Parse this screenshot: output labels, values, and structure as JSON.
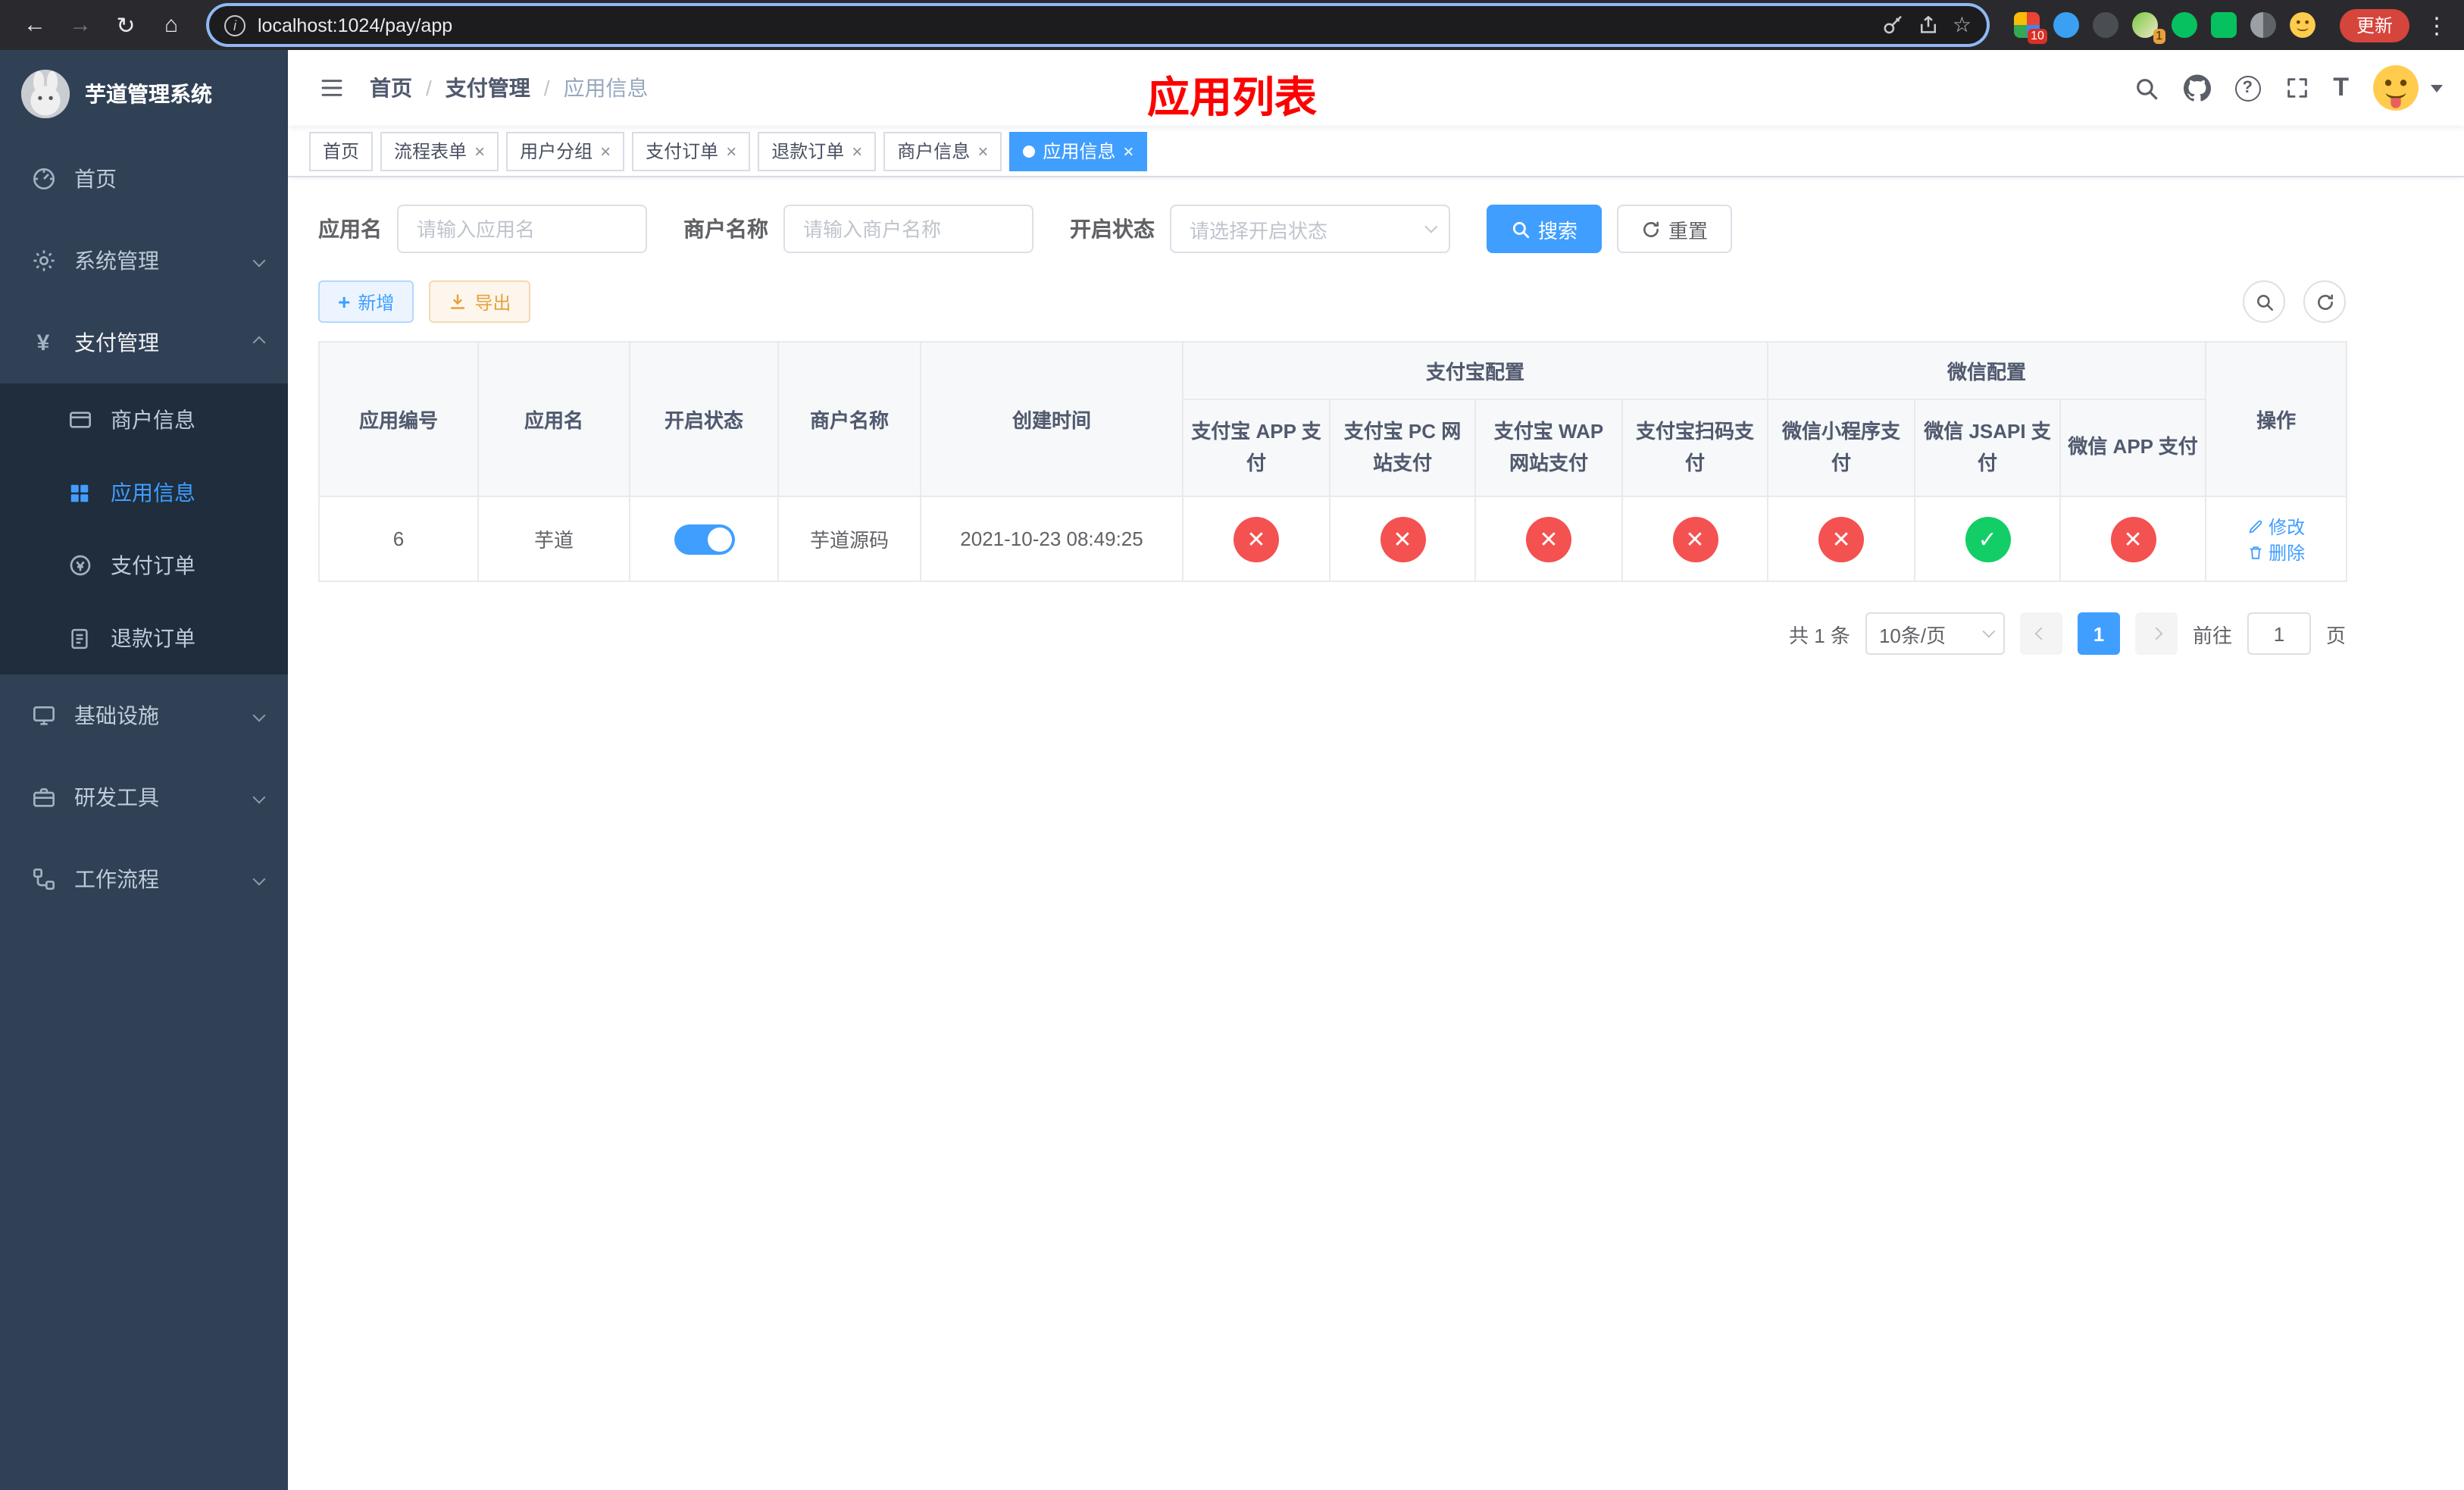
{
  "browser": {
    "url": "localhost:1024/pay/app",
    "update_button": "更新",
    "badge_1": "10",
    "badge_2": "1"
  },
  "icons": {
    "back": "←",
    "forward": "→",
    "reload": "↻",
    "home": "⌂",
    "info": "i",
    "star": "☆",
    "menu_dots": "⋮",
    "close": "×",
    "check": "✓",
    "cross": "✕",
    "question": "?",
    "text_size": "T",
    "yen": "¥",
    "plus": "+"
  },
  "sidebar": {
    "app_title": "芋道管理系统",
    "menu": {
      "home": "首页",
      "system": "系统管理",
      "payment": "支付管理",
      "infra": "基础设施",
      "devtools": "研发工具",
      "workflow": "工作流程"
    },
    "payment_children": {
      "merchant": "商户信息",
      "app": "应用信息",
      "pay_order": "支付订单",
      "refund_order": "退款订单"
    }
  },
  "navbar": {
    "breadcrumb": {
      "home": "首页",
      "section": "支付管理",
      "current": "应用信息",
      "separator": "/"
    },
    "page_title": "应用列表"
  },
  "tags": [
    {
      "label": "首页"
    },
    {
      "label": "流程表单"
    },
    {
      "label": "用户分组"
    },
    {
      "label": "支付订单"
    },
    {
      "label": "退款订单"
    },
    {
      "label": "商户信息"
    },
    {
      "label": "应用信息"
    }
  ],
  "filters": {
    "app_name_label": "应用名",
    "app_name_placeholder": "请输入应用名",
    "merchant_label": "商户名称",
    "merchant_placeholder": "请输入商户名称",
    "status_label": "开启状态",
    "status_placeholder": "请选择开启状态",
    "search_button": "搜索",
    "reset_button": "重置"
  },
  "actions": {
    "add_button": "新增",
    "export_button": "导出"
  },
  "table": {
    "headers": {
      "app_id": "应用编号",
      "app_name": "应用名",
      "status": "开启状态",
      "merchant_name": "商户名称",
      "create_time": "创建时间",
      "alipay_group": "支付宝配置",
      "alipay_app": "支付宝 APP 支付",
      "alipay_pc": "支付宝 PC 网站支付",
      "alipay_wap": "支付宝 WAP 网站支付",
      "alipay_qr": "支付宝扫码支付",
      "wechat_group": "微信配置",
      "wechat_lite": "微信小程序支付",
      "wechat_jsapi": "微信 JSAPI 支付",
      "wechat_app": "微信 APP 支付",
      "actions": "操作"
    },
    "rows": [
      {
        "app_id": "6",
        "app_name": "芋道",
        "status_on": true,
        "merchant_name": "芋道源码",
        "create_time": "2021-10-23 08:49:25",
        "alipay_app": false,
        "alipay_pc": false,
        "alipay_wap": false,
        "alipay_qr": false,
        "wechat_lite": false,
        "wechat_jsapi": true,
        "wechat_app": false,
        "edit_label": "修改",
        "delete_label": "删除"
      }
    ]
  },
  "pagination": {
    "total": "共 1 条",
    "page_size": "10条/页",
    "page": "1",
    "goto_label": "前往",
    "goto_value": "1",
    "goto_unit": "页"
  },
  "colors": {
    "primary": "#409eff",
    "success": "#13ce66",
    "danger": "#f45151",
    "warning": "#e6a23c",
    "sidebar_bg": "#304156",
    "submenu_bg": "#1f2d3d",
    "title_red": "#fe0000",
    "active_tag": "#409eff",
    "update_pill": "#d6453c"
  }
}
